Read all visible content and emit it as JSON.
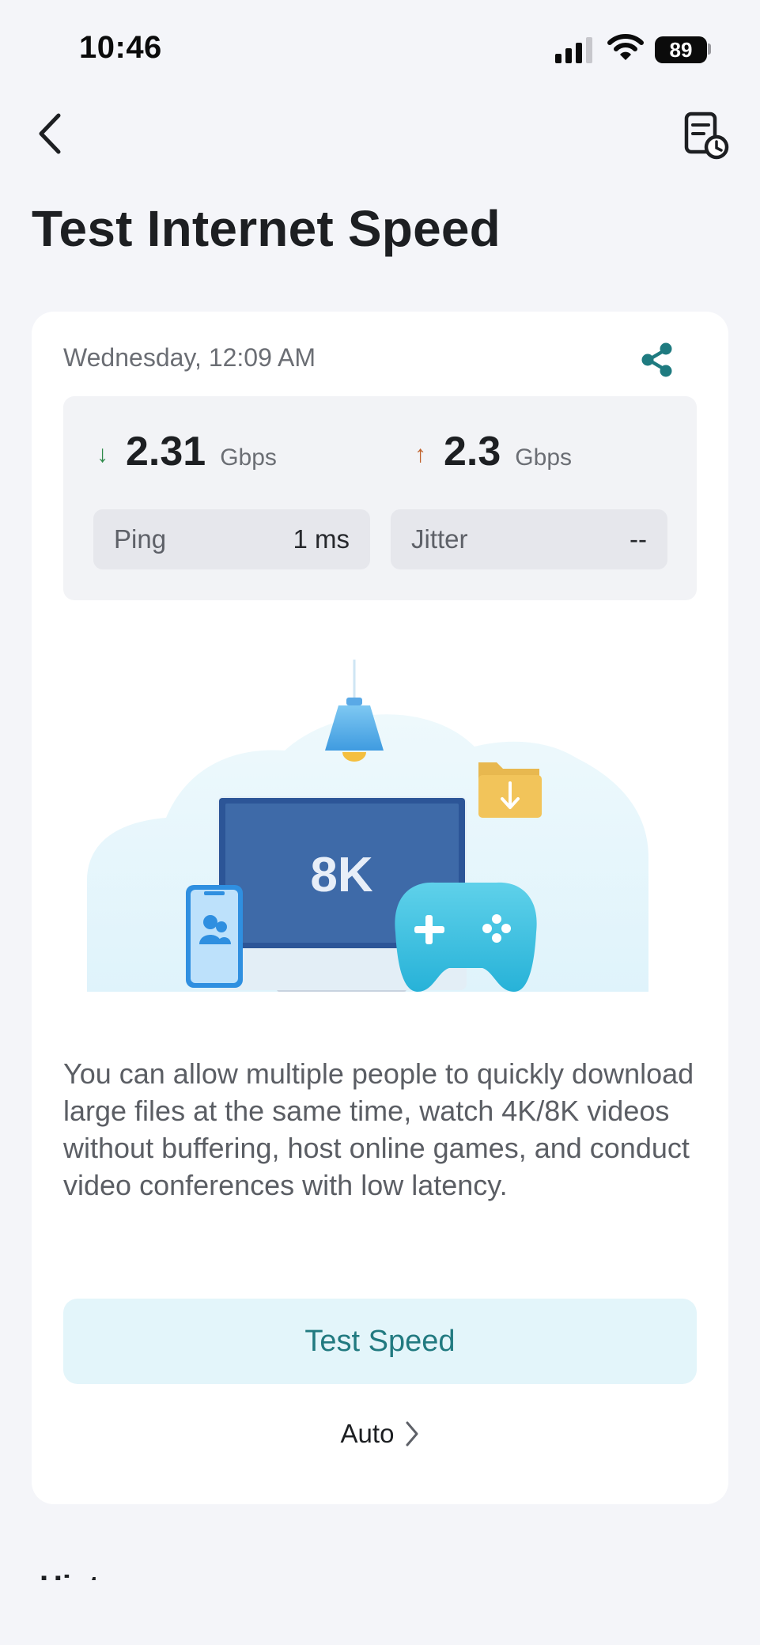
{
  "status_bar": {
    "time": "10:46",
    "battery": "89"
  },
  "header": {
    "title": "Test Internet Speed",
    "back_icon": "chevron-left-icon",
    "history_icon": "report-clock-icon"
  },
  "result": {
    "date": "Wednesday, 12:09 AM",
    "share_icon": "share-icon",
    "download": {
      "arrow": "↓",
      "value": "2.31",
      "unit": "Gbps",
      "color": "#2f8a4a"
    },
    "upload": {
      "arrow": "↑",
      "value": "2.3",
      "unit": "Gbps",
      "color": "#c0622c"
    },
    "ping": {
      "label": "Ping",
      "value": "1 ms"
    },
    "jitter": {
      "label": "Jitter",
      "value": "--"
    }
  },
  "illustration": {
    "screen_text": "8K"
  },
  "description": "You can allow multiple people to quickly download large files at the same time, watch 4K/8K videos without buffering, host online games, and conduct video conferences with low latency.",
  "actions": {
    "test_button": "Test Speed",
    "mode_label": "Auto"
  },
  "history": {
    "heading": "History"
  },
  "colors": {
    "accent": "#217a80",
    "button_bg": "#e3f5fa",
    "page_bg": "#f4f5f9"
  }
}
